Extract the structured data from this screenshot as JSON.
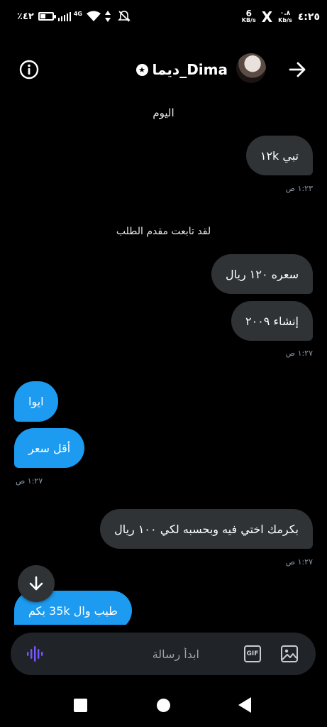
{
  "status_bar": {
    "battery": "٪٤٢",
    "network": "4G",
    "speed_a_value": "6",
    "speed_a_unit": "KB/s",
    "speed_b_value": "٠.٨",
    "speed_b_unit": "Kb/s",
    "x_logo": "X",
    "clock": "٤:٢٥"
  },
  "header": {
    "title": "ديما_Dima",
    "verified_symbol": "★"
  },
  "chat": {
    "date_separator": "اليوم",
    "system_note": "لقد تابعت مقدم الطلب",
    "messages": [
      {
        "text": "تبي ١٢k",
        "direction": "sent"
      },
      {
        "text": "سعره ١٢٠ ريال",
        "direction": "sent"
      },
      {
        "text": "إنشاء ٢٠٠٩",
        "direction": "sent"
      },
      {
        "text": "ايوا",
        "direction": "received"
      },
      {
        "text": "أقل سعر",
        "direction": "received"
      },
      {
        "text": "بكرمك اختي فيه وبحسبه لكي ١٠٠ ريال",
        "direction": "sent"
      },
      {
        "text": "طيب وال 35k بكم",
        "direction": "received"
      }
    ],
    "timestamps": [
      "١:٢٣ ص",
      "١:٢٧ ص",
      "١:٢٧ ص",
      "١:٢٧ ص"
    ]
  },
  "composer": {
    "placeholder": "ابدأ رسالة",
    "gif_label": "GIF"
  },
  "colors": {
    "accent": "#1d9bf0",
    "sent_bubble": "#2f3336",
    "voice_icon": "#7856ff"
  }
}
